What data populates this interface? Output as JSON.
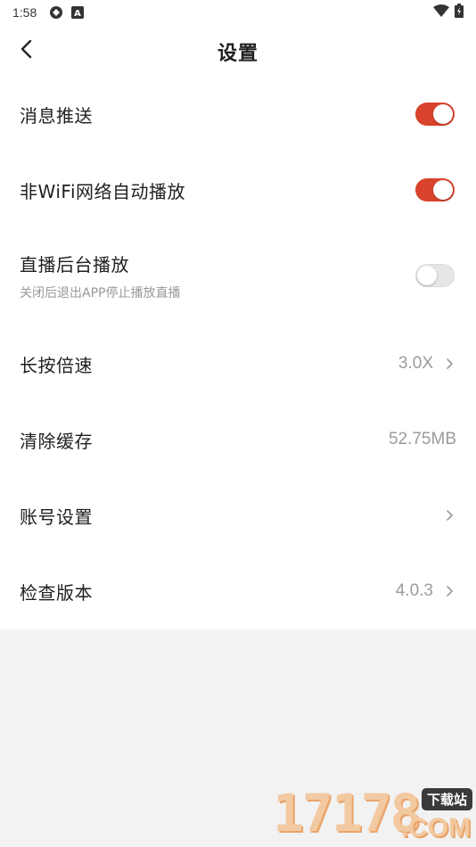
{
  "statusbar": {
    "time": "1:58",
    "icons_left": [
      "sync-icon",
      "a-badge-icon"
    ],
    "icons_right": [
      "wifi-icon",
      "battery-icon"
    ]
  },
  "header": {
    "title": "设置",
    "back_icon": "back-arrow-icon"
  },
  "settings": {
    "push": {
      "label": "消息推送",
      "enabled": true
    },
    "wifi_autoplay": {
      "label": "非WiFi网络自动播放",
      "enabled": true
    },
    "background_play": {
      "label": "直播后台播放",
      "sublabel": "关闭后退出APP停止播放直播",
      "enabled": false
    },
    "long_press_speed": {
      "label": "长按倍速",
      "value": "3.0X"
    },
    "clear_cache": {
      "label": "清除缓存",
      "value": "52.75MB"
    },
    "account": {
      "label": "账号设置"
    },
    "check_version": {
      "label": "检查版本",
      "value": "4.0.3"
    }
  },
  "colors": {
    "accent": "#d9432b",
    "background": "#f2f2f3",
    "panel": "#ffffff",
    "secondary_text": "#9b9b9b"
  },
  "watermark": {
    "digits": "17178",
    "tag": "下载站",
    "suffix": ".COM"
  }
}
